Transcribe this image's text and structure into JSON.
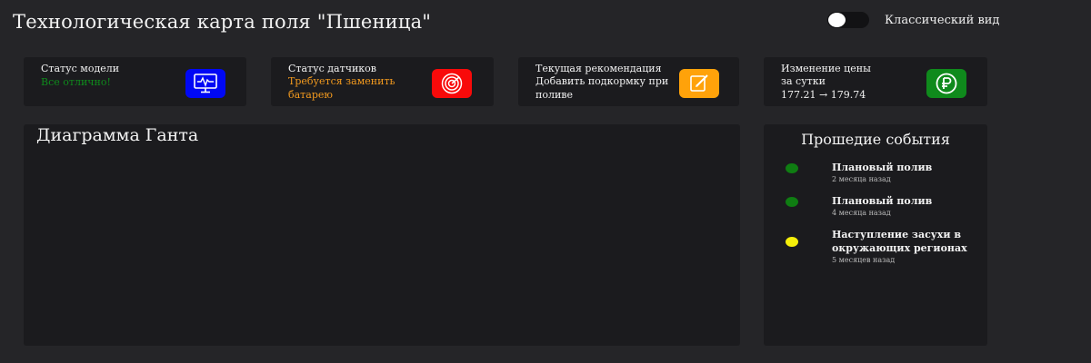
{
  "header": {
    "title": "Технологическая карта поля \"Пшеница\"",
    "toggle_label": "Классический вид",
    "toggle_on": false
  },
  "cards": [
    {
      "title": "Статус модели",
      "value": "Все отлично!",
      "value_color": "#0f8a1c",
      "icon": "monitor-icon",
      "icon_bg": "#0008f5"
    },
    {
      "title": "Статус датчиков",
      "value": "Требуется заменить батарею",
      "value_color": "#f39a1e",
      "icon": "target-icon",
      "icon_bg": "#f80a0a"
    },
    {
      "title": "Текущая рекомендация",
      "value": "Добавить подкормку при поливе",
      "value_color": "#f3f3f3",
      "icon": "edit-icon",
      "icon_bg": "#ffa20a"
    },
    {
      "title": "Изменение цены за сутки",
      "value": "177.21 → 179.74",
      "value_color": "#f3f3f3",
      "icon": "ruble-icon",
      "icon_bg": "#0f8a1c"
    }
  ],
  "gantt": {
    "title": "Диаграмма Ганта"
  },
  "events": {
    "title": "Прошедие события",
    "items": [
      {
        "title": "Плановый полив",
        "time": "2 месяца назад",
        "color": "#0f7d12"
      },
      {
        "title": "Плановый полив",
        "time": "4 месяца назад",
        "color": "#0f7d12"
      },
      {
        "title": "Наступление засухи в окружающих регионах",
        "time": "5 месяцев назад",
        "color": "#f5ef0a"
      }
    ]
  }
}
